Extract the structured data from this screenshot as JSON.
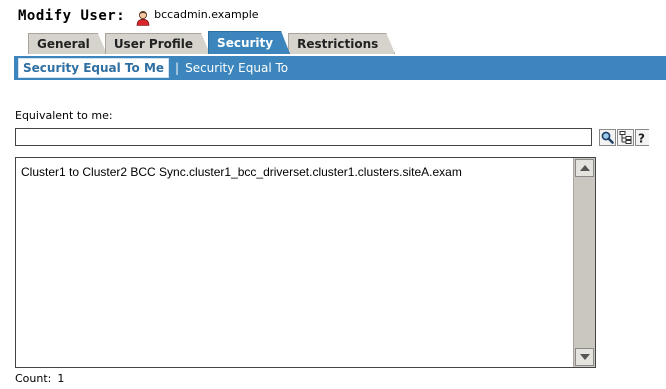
{
  "header": {
    "title": "Modify User:",
    "user_icon": "user-icon",
    "user_name": "bccadmin.example"
  },
  "tabs": [
    {
      "label": "General",
      "active": false
    },
    {
      "label": "User Profile",
      "active": false
    },
    {
      "label": "Security",
      "active": true
    },
    {
      "label": "Restrictions",
      "active": false
    }
  ],
  "subnav": {
    "active_label": "Security Equal To Me",
    "separator": "|",
    "other_label": "Security Equal To"
  },
  "equivalent": {
    "label": "Equivalent to me:",
    "input_value": "",
    "buttons": [
      "search-icon",
      "browse-tree-icon",
      "help-icon"
    ],
    "items": [
      "Cluster1 to Cluster2 BCC Sync.cluster1_bcc_driverset.cluster1.clusters.siteA.exam"
    ]
  },
  "count": {
    "label": "Count:",
    "value": "1"
  },
  "colors": {
    "accent": "#3c86bd",
    "tab_inactive": "#d6d3cc",
    "scrollbar": "#c9c7c0"
  }
}
